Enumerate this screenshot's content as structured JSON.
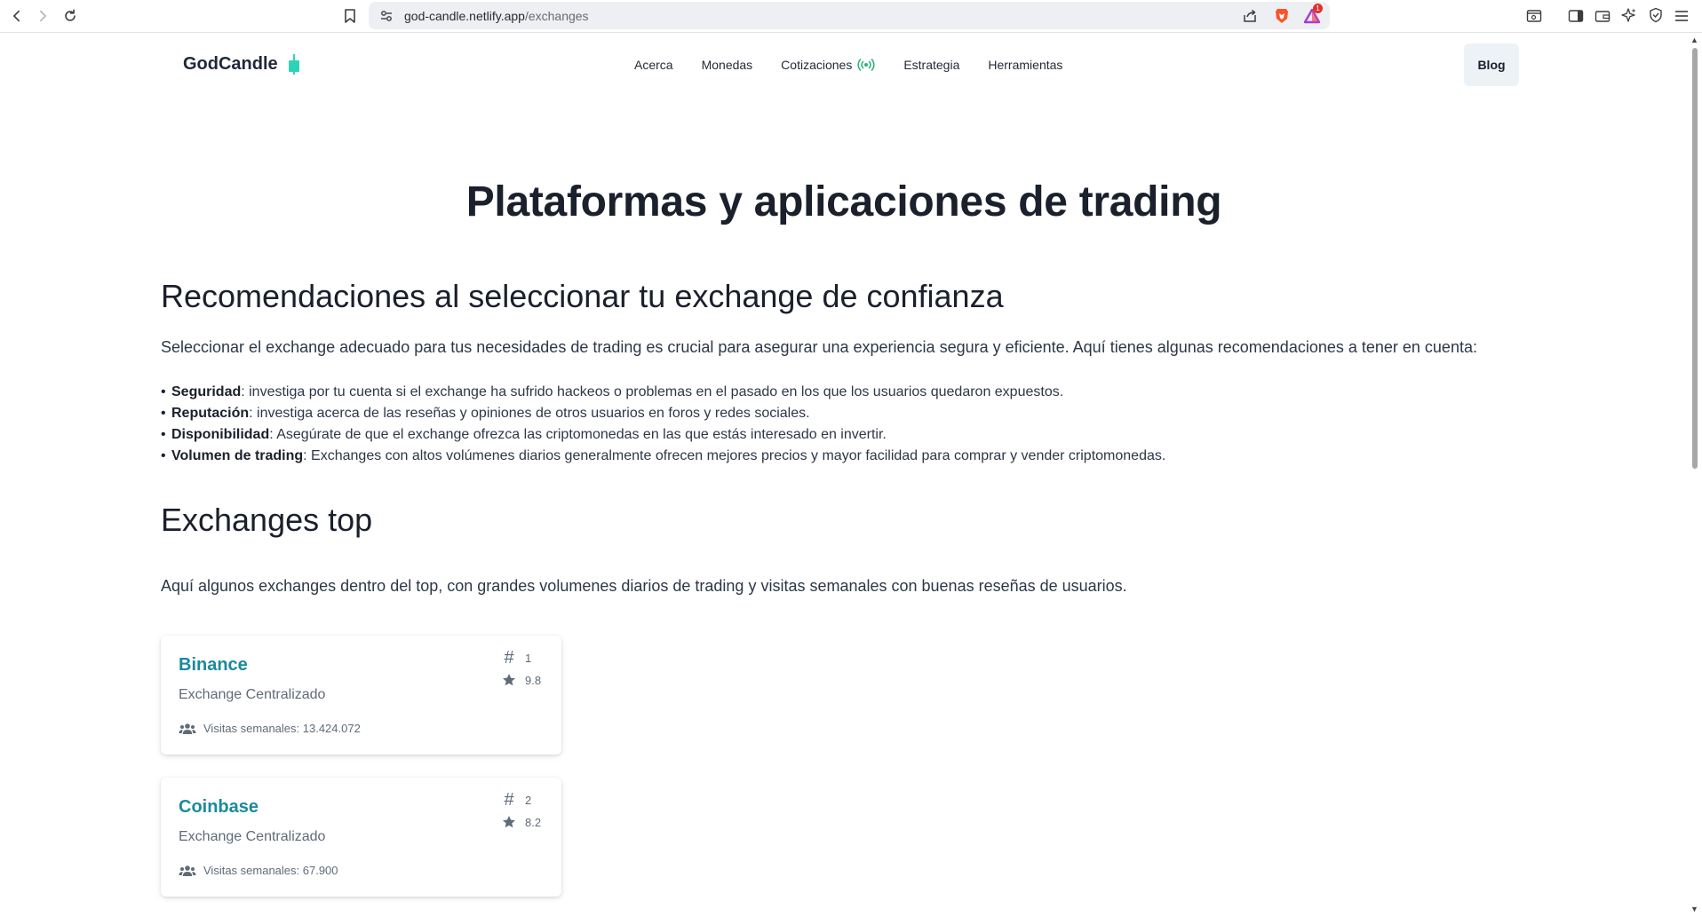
{
  "browser": {
    "url_host": "god-candle.netlify.app",
    "url_path": "/exchanges",
    "notification_count": "1"
  },
  "header": {
    "brand": "GodCandle",
    "nav": [
      {
        "label": "Acerca"
      },
      {
        "label": "Monedas"
      },
      {
        "label": "Cotizaciones"
      },
      {
        "label": "Estrategia"
      },
      {
        "label": "Herramientas"
      }
    ],
    "blog_label": "Blog"
  },
  "main": {
    "title": "Plataformas y aplicaciones de trading",
    "recommendations": {
      "heading": "Recomendaciones al seleccionar tu exchange de confianza",
      "intro": "Seleccionar el exchange adecuado para tus necesidades de trading es crucial para asegurar una experiencia segura y eficiente. Aquí tienes algunas recomendaciones a tener en cuenta:",
      "items": [
        {
          "term": "Seguridad",
          "text": ": investiga por tu cuenta si el exchange ha sufrido hackeos o problemas en el pasado en los que los usuarios quedaron expuestos."
        },
        {
          "term": "Reputación",
          "text": ": investiga acerca de las reseñas y opiniones de otros usuarios en foros y redes sociales."
        },
        {
          "term": "Disponibilidad",
          "text": ": Asegúrate de que el exchange ofrezca las criptomonedas en las que estás interesado en invertir."
        },
        {
          "term": "Volumen de trading",
          "text": ": Exchanges con altos volúmenes diarios generalmente ofrecen mejores precios y mayor facilidad para comprar y vender criptomonedas."
        }
      ]
    },
    "top": {
      "heading": "Exchanges top",
      "intro": "Aquí algunos exchanges dentro del top, con grandes volumenes diarios de trading y visitas semanales con buenas reseñas de usuarios.",
      "exchanges": [
        {
          "name": "Binance",
          "type": "Exchange Centralizado",
          "visits": "Visitas semanales: 13.424.072",
          "rank": "1",
          "score": "9.8"
        },
        {
          "name": "Coinbase",
          "type": "Exchange Centralizado",
          "visits": "Visitas semanales: 67.900",
          "rank": "2",
          "score": "8.2"
        }
      ]
    }
  },
  "colors": {
    "accent": "#1a8a9e",
    "candle": "#2ed3b7",
    "live": "#2fb37a"
  }
}
